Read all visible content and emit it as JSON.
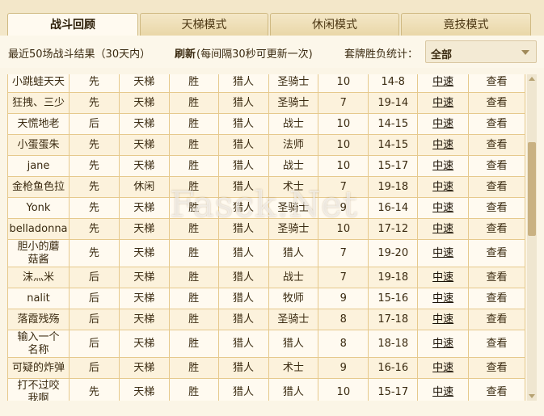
{
  "tabs": [
    {
      "label": "战斗回顾",
      "active": true
    },
    {
      "label": "天梯模式",
      "active": false
    },
    {
      "label": "休闲模式",
      "active": false
    },
    {
      "label": "竟技模式",
      "active": false
    }
  ],
  "filter": {
    "recent_label": "最近50场战斗结果（30天内）",
    "refresh_key": "刷新",
    "refresh_note": "(每间隔30秒可更新一次)",
    "stats_label": "套牌胜负统计：",
    "select_value": "全部"
  },
  "watermark": "Fasck.Net",
  "rows": [
    {
      "player": "小跳蛙天天",
      "order": "先",
      "mode": "天梯",
      "result": "胜",
      "hero": "猎人",
      "opponent": "圣骑士",
      "turns": "10",
      "score": "14-8",
      "speed": "中速",
      "action": "查看"
    },
    {
      "player": "狂拽、三少",
      "order": "先",
      "mode": "天梯",
      "result": "胜",
      "hero": "猎人",
      "opponent": "圣骑士",
      "turns": "7",
      "score": "19-14",
      "speed": "中速",
      "action": "查看"
    },
    {
      "player": "天慌地老",
      "order": "后",
      "mode": "天梯",
      "result": "胜",
      "hero": "猎人",
      "opponent": "战士",
      "turns": "10",
      "score": "14-15",
      "speed": "中速",
      "action": "查看"
    },
    {
      "player": "小蛋蛋朱",
      "order": "先",
      "mode": "天梯",
      "result": "胜",
      "hero": "猎人",
      "opponent": "法师",
      "turns": "10",
      "score": "14-15",
      "speed": "中速",
      "action": "查看"
    },
    {
      "player": "jane",
      "order": "先",
      "mode": "天梯",
      "result": "胜",
      "hero": "猎人",
      "opponent": "战士",
      "turns": "10",
      "score": "15-17",
      "speed": "中速",
      "action": "查看"
    },
    {
      "player": "金枪鱼色拉",
      "order": "先",
      "mode": "休闲",
      "result": "胜",
      "hero": "猎人",
      "opponent": "术士",
      "turns": "7",
      "score": "19-18",
      "speed": "中速",
      "action": "查看"
    },
    {
      "player": "Yonk",
      "order": "先",
      "mode": "天梯",
      "result": "胜",
      "hero": "猎人",
      "opponent": "圣骑士",
      "turns": "9",
      "score": "16-14",
      "speed": "中速",
      "action": "查看"
    },
    {
      "player": "belladonna",
      "order": "先",
      "mode": "天梯",
      "result": "胜",
      "hero": "猎人",
      "opponent": "圣骑士",
      "turns": "10",
      "score": "17-12",
      "speed": "中速",
      "action": "查看"
    },
    {
      "player": "胆小的蘑菇酱",
      "order": "先",
      "mode": "天梯",
      "result": "胜",
      "hero": "猎人",
      "opponent": "猎人",
      "turns": "7",
      "score": "19-20",
      "speed": "中速",
      "action": "查看",
      "tall": true
    },
    {
      "player": "沫灬米",
      "order": "后",
      "mode": "天梯",
      "result": "胜",
      "hero": "猎人",
      "opponent": "战士",
      "turns": "7",
      "score": "19-18",
      "speed": "中速",
      "action": "查看"
    },
    {
      "player": "nalit",
      "order": "后",
      "mode": "天梯",
      "result": "胜",
      "hero": "猎人",
      "opponent": "牧师",
      "turns": "9",
      "score": "15-16",
      "speed": "中速",
      "action": "查看"
    },
    {
      "player": "落霞残殇",
      "order": "后",
      "mode": "天梯",
      "result": "胜",
      "hero": "猎人",
      "opponent": "圣骑士",
      "turns": "8",
      "score": "17-18",
      "speed": "中速",
      "action": "查看"
    },
    {
      "player": "输入一个名称",
      "order": "后",
      "mode": "天梯",
      "result": "胜",
      "hero": "猎人",
      "opponent": "猎人",
      "turns": "8",
      "score": "18-18",
      "speed": "中速",
      "action": "查看",
      "tall": true
    },
    {
      "player": "可疑的炸弹",
      "order": "后",
      "mode": "天梯",
      "result": "胜",
      "hero": "猎人",
      "opponent": "术士",
      "turns": "9",
      "score": "16-16",
      "speed": "中速",
      "action": "查看"
    },
    {
      "player": "打不过咬我啊",
      "order": "先",
      "mode": "天梯",
      "result": "胜",
      "hero": "猎人",
      "opponent": "猎人",
      "turns": "10",
      "score": "15-17",
      "speed": "中速",
      "action": "查看",
      "tall": true
    }
  ]
}
